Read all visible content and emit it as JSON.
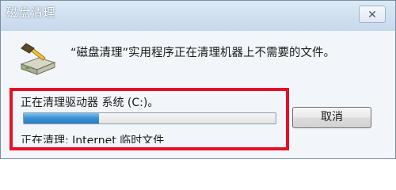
{
  "window": {
    "title": "磁盘清理",
    "close_glyph": "✕"
  },
  "dialog": {
    "message": "“磁盘清理”实用程序正在清理机器上不需要的文件。",
    "status": "正在清理驱动器 系统 (C:)。",
    "progress_fraction": 0.3,
    "cleaning": "正在清理: Internet 临时文件",
    "cancel_label": "取消",
    "icon": "disk-cleanup-icon"
  },
  "colors": {
    "highlight_border": "#e4102a",
    "progress_fill": "#3b93d6"
  }
}
